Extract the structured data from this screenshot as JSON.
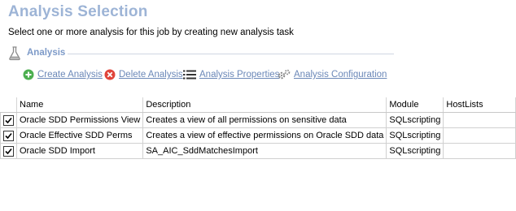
{
  "page": {
    "title": "Analysis Selection",
    "subtitle": "Select one or more analysis for this job by creating new analysis task"
  },
  "group": {
    "label": "Analysis",
    "icon": "flask-icon"
  },
  "toolbar": {
    "create_label": "Create Analysis",
    "delete_label": "Delete Analysis",
    "properties_label": "Analysis Properties",
    "configuration_label": "Analysis Configuration"
  },
  "table": {
    "headers": [
      "Name",
      "Description",
      "Module",
      "HostLists"
    ],
    "rows": [
      {
        "checked": true,
        "name": "Oracle SDD Permissions View",
        "description": "Creates a view of all permissions on sensitive data",
        "module": "SQLscripting",
        "hostlists": ""
      },
      {
        "checked": true,
        "name": "Oracle Effective SDD Perms",
        "description": "Creates a view of effective permissions on Oracle SDD data",
        "module": "SQLscripting",
        "hostlists": ""
      },
      {
        "checked": true,
        "name": "Oracle SDD Import",
        "description": "SA_AIC_SddMatchesImport",
        "module": "SQLscripting",
        "hostlists": ""
      }
    ]
  },
  "colors": {
    "title": "#9db4d6",
    "link": "#6b88b8",
    "create_icon": "#4caf50",
    "delete_icon": "#e0443a"
  }
}
